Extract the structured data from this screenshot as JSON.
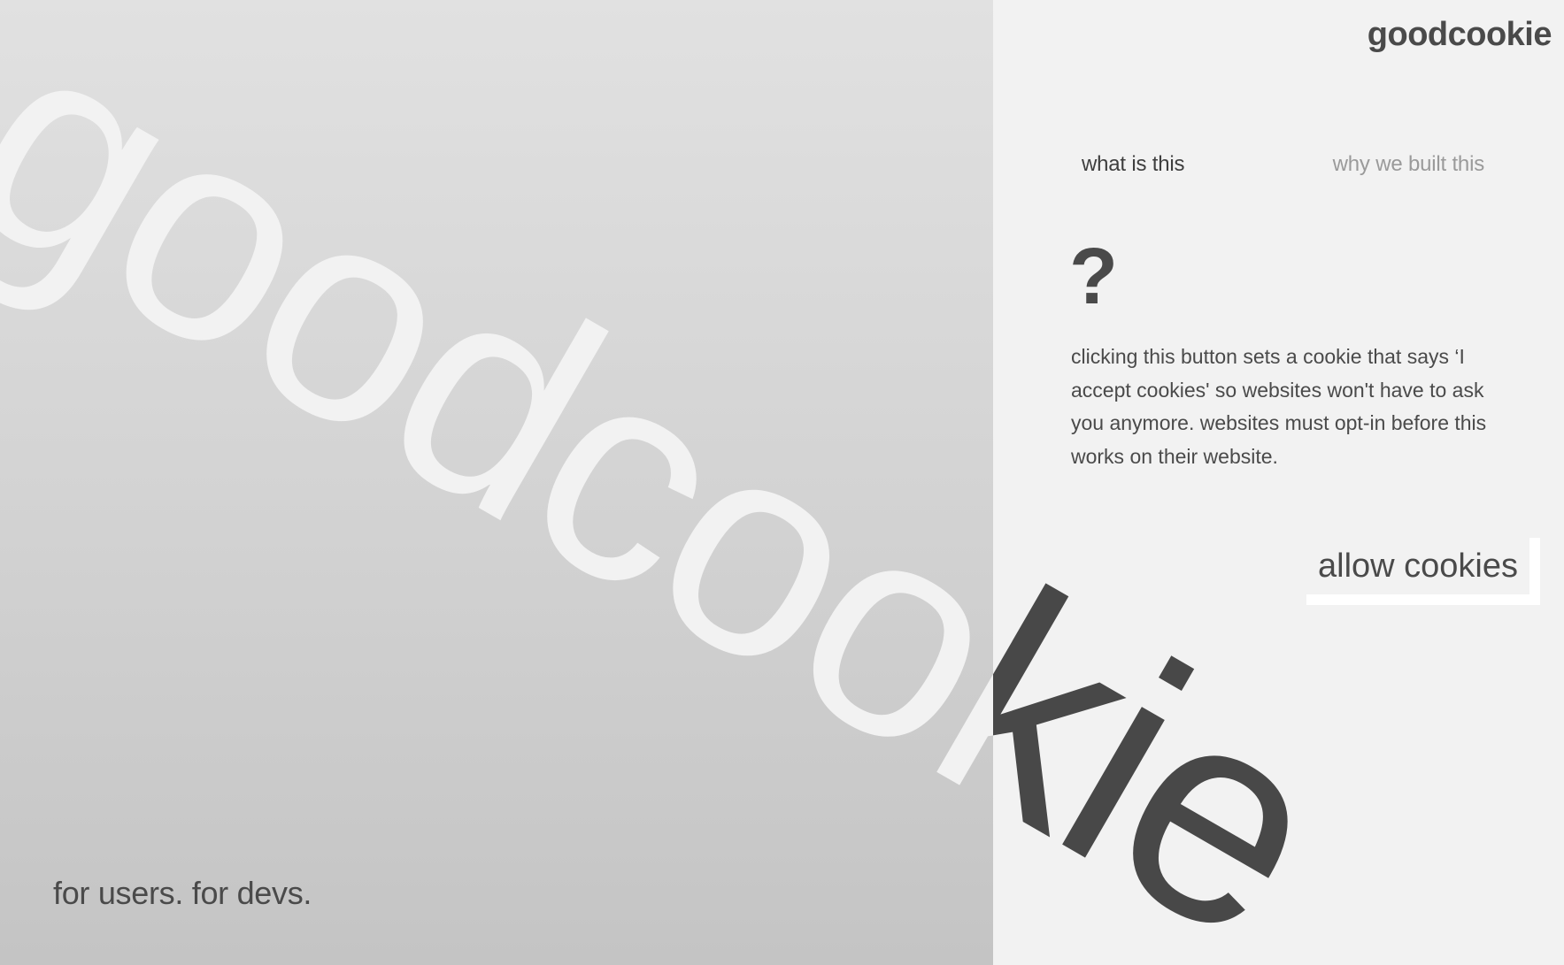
{
  "brand": {
    "logo_text": "goodcookie",
    "wordmark_text": "goodcookie",
    "colors": {
      "left_top": "#e1e1e1",
      "left_bottom": "#c4c4c4",
      "right_background": "#f2f2f2",
      "text_dark": "#4a4a4a",
      "text_muted": "#9a9a9a",
      "wordmark_light": "#f2f2f2",
      "wordmark_dark": "#484848"
    }
  },
  "nav": {
    "tabs": [
      {
        "label": "what is this",
        "active": true
      },
      {
        "label": "why we built this",
        "active": false
      }
    ]
  },
  "content": {
    "icon_glyph": "?",
    "icon_name": "question-mark-icon",
    "description": "clicking this button sets a cookie that says ‘I accept cookies' so websites won't have to ask you anymore. websites must opt-in before this works on their website."
  },
  "action": {
    "allow_label": "allow cookies"
  },
  "footer": {
    "tagline": "for users. for devs."
  }
}
